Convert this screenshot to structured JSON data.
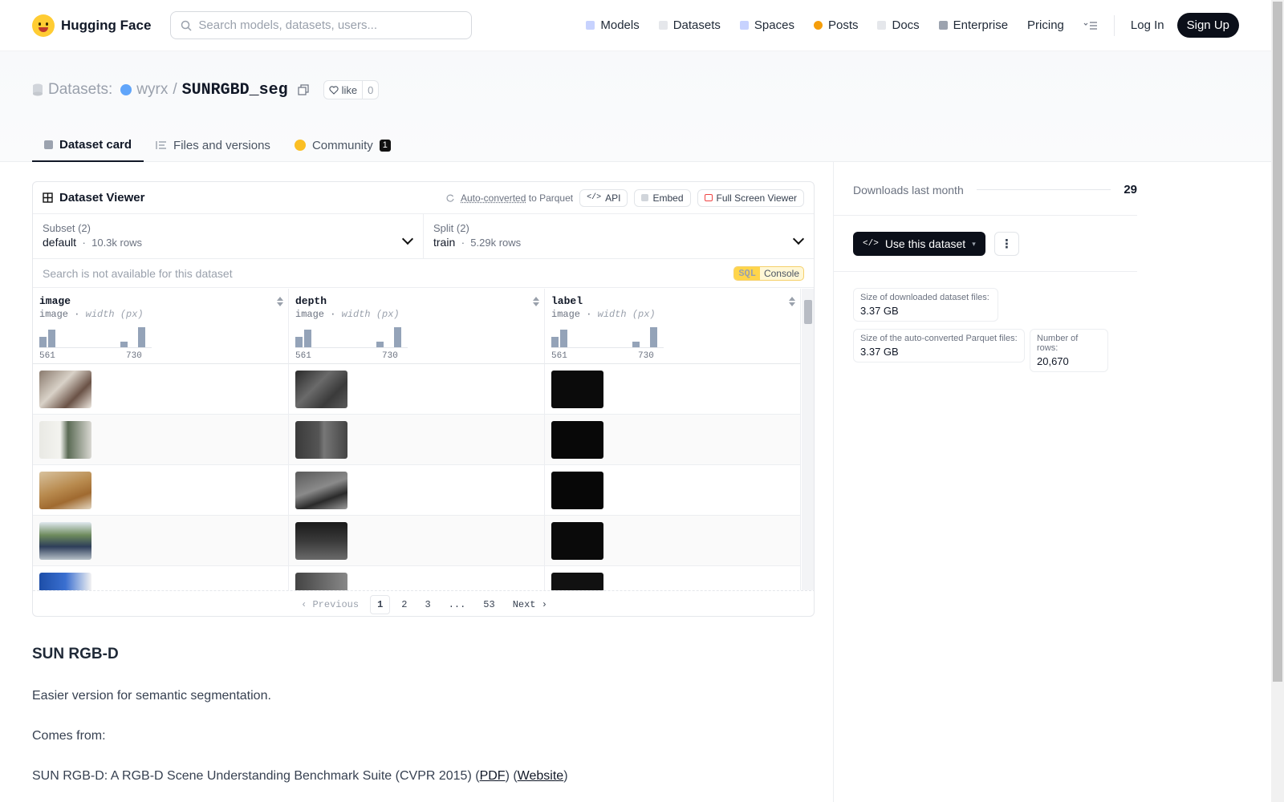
{
  "header": {
    "brand": "Hugging Face",
    "search_placeholder": "Search models, datasets, users...",
    "nav": [
      {
        "label": "Models",
        "color": "#a5b4fc"
      },
      {
        "label": "Datasets",
        "color": "#e5e7eb"
      },
      {
        "label": "Spaces",
        "color": "#c7d2fe"
      },
      {
        "label": "Posts",
        "color": "#f59e0b"
      },
      {
        "label": "Docs",
        "color": "#e5e7eb"
      },
      {
        "label": "Enterprise",
        "color": "#9ca3af"
      }
    ],
    "pricing": "Pricing",
    "login": "Log In",
    "signup": "Sign Up"
  },
  "repo": {
    "prefix": "Datasets:",
    "owner": "wyrx",
    "slash": "/",
    "name": "SUNRGBD_seg",
    "like_label": "like",
    "like_count": "0"
  },
  "tabs": [
    {
      "label": "Dataset card",
      "active": true
    },
    {
      "label": "Files and versions"
    },
    {
      "label": "Community",
      "badge": "1"
    }
  ],
  "viewer": {
    "title": "Dataset Viewer",
    "auto_converted": "Auto-converted",
    "to_parquet": "to Parquet",
    "api": "API",
    "embed": "Embed",
    "fullscreen": "Full Screen Viewer",
    "subset_label": "Subset (2)",
    "subset_value": "default",
    "subset_rows": "10.3k rows",
    "split_label": "Split (2)",
    "split_value": "train",
    "split_rows": "5.29k rows",
    "search_placeholder": "Search is not available for this dataset",
    "sql": "SQL",
    "console": "Console",
    "columns": [
      {
        "name": "image",
        "type": "image",
        "sub": "width (px)",
        "min": "561",
        "max": "730",
        "hist": [
          0.45,
          0.8,
          0.0,
          0.0,
          0.0,
          0.0,
          0.0,
          0.0,
          0.0,
          0.25,
          0.0,
          0.9
        ]
      },
      {
        "name": "depth",
        "type": "image",
        "sub": "width (px)",
        "min": "561",
        "max": "730",
        "hist": [
          0.45,
          0.8,
          0.0,
          0.0,
          0.0,
          0.0,
          0.0,
          0.0,
          0.0,
          0.25,
          0.0,
          0.9
        ]
      },
      {
        "name": "label",
        "type": "image",
        "sub": "width (px)",
        "min": "561",
        "max": "730",
        "hist": [
          0.45,
          0.8,
          0.0,
          0.0,
          0.0,
          0.0,
          0.0,
          0.0,
          0.0,
          0.25,
          0.0,
          0.9
        ]
      }
    ],
    "pager": {
      "prev": "Previous",
      "pages": [
        "1",
        "2",
        "3",
        "...",
        "53"
      ],
      "next": "Next"
    }
  },
  "content": {
    "heading": "SUN RGB-D",
    "p1": "Easier version for semantic segmentation.",
    "p2": "Comes from:",
    "p3_text": "SUN RGB-D: A RGB-D Scene Understanding Benchmark Suite (CVPR 2015) (",
    "p3_link1": "PDF",
    "p3_mid": ") (",
    "p3_link2": "Website",
    "p3_end": ")"
  },
  "sidebar": {
    "downloads_label": "Downloads last month",
    "downloads_value": "29",
    "use_button": "Use this dataset",
    "more": "⋮",
    "stats": [
      {
        "k": "Size of downloaded dataset files:",
        "v": "3.37 GB"
      },
      {
        "k": "Size of the auto-converted Parquet files:",
        "v": "3.37 GB"
      },
      {
        "k": "Number of rows:",
        "v": "20,670"
      }
    ]
  }
}
